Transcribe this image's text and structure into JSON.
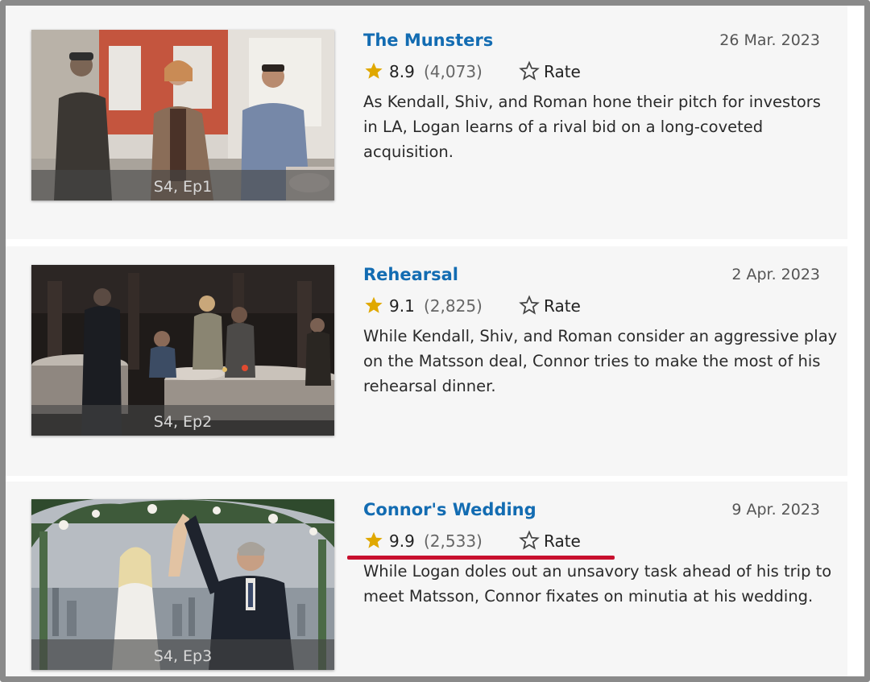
{
  "colors": {
    "title": "#136cb2",
    "star": "#e0a800",
    "annotation_underline": "#c8102e"
  },
  "episodes": [
    {
      "title": "The Munsters",
      "air_date": "26 Mar. 2023",
      "rating": "8.9",
      "votes": "(4,073)",
      "rate_label": "Rate",
      "episode_label": "S4, Ep1",
      "description": "As Kendall, Shiv, and Roman hone their pitch for investors in LA, Logan learns of a rival bid on a long-coveted acquisition."
    },
    {
      "title": "Rehearsal",
      "air_date": "2 Apr. 2023",
      "rating": "9.1",
      "votes": "(2,825)",
      "rate_label": "Rate",
      "episode_label": "S4, Ep2",
      "description": "While Kendall, Shiv, and Roman consider an aggressive play on the Matsson deal, Connor tries to make the most of his rehearsal dinner."
    },
    {
      "title": "Connor's Wedding",
      "air_date": "9 Apr. 2023",
      "rating": "9.9",
      "votes": "(2,533)",
      "rate_label": "Rate",
      "episode_label": "S4, Ep3",
      "description": "While Logan doles out an unsavory task ahead of his trip to meet Matsson, Connor fixates on minutia at his wedding."
    }
  ],
  "icons": {
    "rating_star": "star-filled-icon",
    "rate_star": "star-outline-icon"
  }
}
